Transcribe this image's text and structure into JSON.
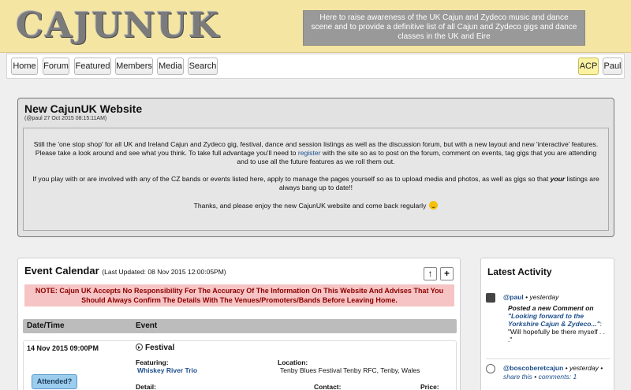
{
  "header": {
    "logo_text": "CAJUNUK",
    "tagline": "Here to raise awareness of the UK Cajun and Zydeco music and dance scene and to provide a definitive list of all Cajun and Zydeco gigs and dance classes in the UK and Eire"
  },
  "nav": {
    "items": [
      "Home",
      "Forum",
      "Featured",
      "Members",
      "Media",
      "Search"
    ],
    "acp": "ACP",
    "user": "Paul"
  },
  "announcement": {
    "title": "New CajunUK Website",
    "meta": "(@paul 27 Oct 2015 08:15:11AM)",
    "p1_a": "Still the 'one stop shop' for all UK and Ireland Cajun and Zydeco gig, festival, dance and session listings as well as the discussion forum, but with a new layout and new 'interactive' features. Please take a look around and see what you think. To take full advantage you'll need to ",
    "p1_link": "register",
    "p1_b": " with the site so as to post on the forum, comment on events, tag gigs that you are attending and to use all the future features as we roll them out.",
    "p2_a": "If you play with or are involved with any of the CZ bands or events listed here, apply to manage the pages yourself so as to upload media and photos, as well as gigs so that ",
    "p2_em": "your",
    "p2_b": " listings are always bang up to date!!",
    "p3": "Thanks, and please enjoy the new CajunUK website and come back regularly"
  },
  "calendar": {
    "title": "Event Calendar",
    "updated": "(Last Updated: 08 Nov 2015 12:00:05PM)",
    "up_label": "↑",
    "add_label": "+",
    "note": "NOTE: Cajun UK Accepts No Responsibility For The Accuracy Of The Information On This Website And Advises That You Should Always Confirm The Details With The Venues/Promoters/Bands Before Leaving Home.",
    "col_date": "Date/Time",
    "col_event": "Event",
    "event": {
      "datetime": "14 Nov 2015 09:00PM",
      "type": "Festival",
      "featuring_label": "Featuring:",
      "featuring": "Whiskey River Trio",
      "location_label": "Location:",
      "location": "Tenby Blues Festival Tenby RFC, Tenby, Wales",
      "detail_label": "Detail:",
      "contact_label": "Contact:",
      "price_label": "Price:",
      "attended": "Attended?"
    }
  },
  "activity": {
    "title": "Latest Activity",
    "item1": {
      "user": "@paul",
      "time": " • yesterday",
      "action": "Posted a new Comment on",
      "link": "\"Looking forward to the Yorkshire Cajun & Zydeco...\"",
      "colon": ":",
      "quote": "\"Will hopefully be there myself . . .\""
    },
    "item2": {
      "user": "@boscoberetcajun",
      "time": " • yesterday •",
      "share": "share this",
      "comments": "comments: 1"
    }
  },
  "colors": {
    "header_bg": "#f4e5a3",
    "note_bg": "#f6c4c4",
    "note_text": "#8b0000",
    "link": "#1d4f8c",
    "attended_bg": "#9ccdef",
    "acp_bg": "#fbf2a4"
  }
}
